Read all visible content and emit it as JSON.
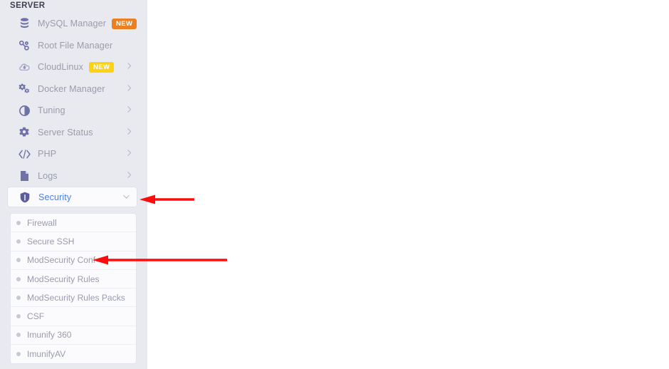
{
  "sidebar": {
    "section_title": "SERVER",
    "items": [
      {
        "label": "MySQL Manager",
        "icon": "database-icon",
        "badge": "NEW",
        "badge_color": "#ea8022",
        "chevron": false,
        "active": false
      },
      {
        "label": "Root File Manager",
        "icon": "file-nodes-icon",
        "badge": "",
        "badge_color": "",
        "chevron": false,
        "active": false
      },
      {
        "label": "CloudLinux",
        "icon": "cloudlinux-icon",
        "badge": "NEW",
        "badge_color": "#fdd213",
        "chevron": true,
        "active": false
      },
      {
        "label": "Docker Manager",
        "icon": "gears-icon",
        "badge": "",
        "badge_color": "",
        "chevron": true,
        "active": false
      },
      {
        "label": "Tuning",
        "icon": "contrast-icon",
        "badge": "",
        "badge_color": "",
        "chevron": true,
        "active": false
      },
      {
        "label": "Server Status",
        "icon": "gear-icon",
        "badge": "",
        "badge_color": "",
        "chevron": true,
        "active": false
      },
      {
        "label": "PHP",
        "icon": "code-icon",
        "badge": "",
        "badge_color": "",
        "chevron": true,
        "active": false
      },
      {
        "label": "Logs",
        "icon": "document-icon",
        "badge": "",
        "badge_color": "",
        "chevron": true,
        "active": false
      },
      {
        "label": "Security",
        "icon": "shield-icon",
        "badge": "",
        "badge_color": "",
        "chevron": true,
        "active": true
      }
    ],
    "submenu": {
      "parent": "Security",
      "items": [
        {
          "label": "Firewall"
        },
        {
          "label": "Secure SSH"
        },
        {
          "label": "ModSecurity Conf"
        },
        {
          "label": "ModSecurity Rules"
        },
        {
          "label": "ModSecurity Rules Packs"
        },
        {
          "label": "CSF"
        },
        {
          "label": "Imunify 360"
        },
        {
          "label": "ImunifyAV"
        }
      ]
    }
  },
  "annotations": {
    "color": "#fb0d0d",
    "arrows": [
      {
        "name": "arrow-to-security",
        "points_to": "Security"
      },
      {
        "name": "arrow-to-modsecurity-conf",
        "points_to": "ModSecurity Conf"
      }
    ]
  },
  "colors": {
    "sidebar_bg": "#e9eaef",
    "panel_bg": "#fbfbfd",
    "text_muted": "#9a9cab",
    "icon": "#6f71a8",
    "active_text": "#4a7ef0",
    "content_bg": "#ffffff"
  }
}
